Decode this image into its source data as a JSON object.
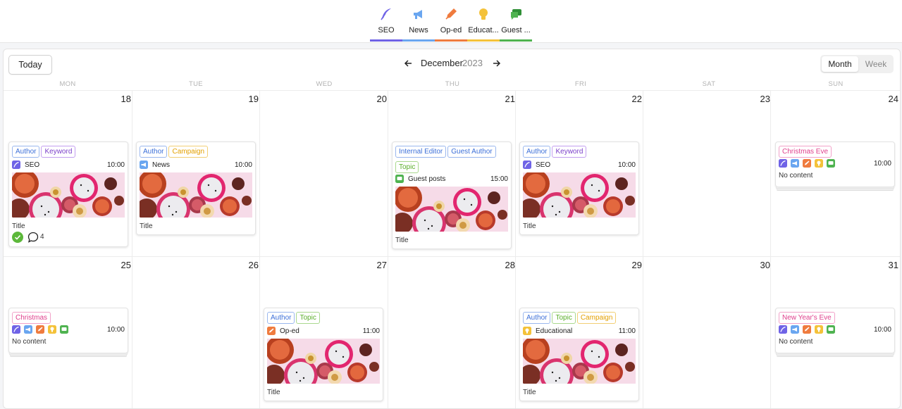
{
  "top_tabs": [
    {
      "label": "SEO",
      "icon": "feather-pen-icon",
      "color": "#6f63e6",
      "active": true
    },
    {
      "label": "News",
      "icon": "megaphone-icon",
      "color": "#6aa6f0",
      "active": false
    },
    {
      "label": "Op-ed",
      "icon": "fountain-pen-icon",
      "color": "#ef7b3e",
      "active": false
    },
    {
      "label": "Educat...",
      "icon": "lightbulb-icon",
      "color": "#f4c23a",
      "active": false
    },
    {
      "label": "Guest ...",
      "icon": "chat-bubbles-icon",
      "color": "#4fb350",
      "active": false
    }
  ],
  "toolbar": {
    "today_label": "Today",
    "month": "December",
    "year": "2023",
    "view_month": "Month",
    "view_week": "Week",
    "active_view": "Month"
  },
  "weekdays": [
    "MON",
    "TUE",
    "WED",
    "THU",
    "FRI",
    "SAT",
    "SUN"
  ],
  "weeks": [
    [
      "18",
      "19",
      "20",
      "21",
      "22",
      "23",
      "24"
    ],
    [
      "25",
      "26",
      "27",
      "28",
      "29",
      "30",
      "31"
    ]
  ],
  "cards": {
    "w1_mon": {
      "tags": [
        "Author",
        "Keyword"
      ],
      "type": "SEO",
      "time": "10:00",
      "title": "Title",
      "comment_count": "4"
    },
    "w1_tue": {
      "tags": [
        "Author",
        "Campaign"
      ],
      "type": "News",
      "time": "10:00",
      "title": "Title"
    },
    "w1_thu": {
      "tags": [
        "Internal Editor",
        "Guest Author",
        "Topic"
      ],
      "type": "Guest posts",
      "time": "15:00",
      "title": "Title"
    },
    "w1_fri": {
      "tags": [
        "Author",
        "Keyword"
      ],
      "type": "SEO",
      "time": "10:00",
      "title": "Title"
    },
    "w1_sun": {
      "tags": [
        "Christmas Eve"
      ],
      "time": "10:00",
      "empty_text": "No content"
    },
    "w2_mon": {
      "tags": [
        "Christmas"
      ],
      "time": "10:00",
      "empty_text": "No content"
    },
    "w2_wed": {
      "tags": [
        "Author",
        "Topic"
      ],
      "type": "Op-ed",
      "time": "11:00",
      "title": "Title"
    },
    "w2_fri": {
      "tags": [
        "Author",
        "Topic",
        "Campaign"
      ],
      "type": "Educational",
      "time": "11:00",
      "title": "Title"
    },
    "w2_sun": {
      "tags": [
        "New Year's Eve"
      ],
      "time": "10:00",
      "empty_text": "No content"
    }
  }
}
